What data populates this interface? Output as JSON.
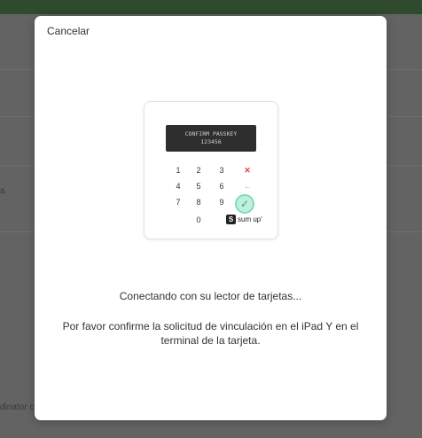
{
  "modal": {
    "cancel_label": "Cancelar",
    "status": "Conectando con su lector de tarjetas...",
    "instructions": "Por favor confirme la solicitud de vinculación en el iPad Y en el terminal de la tarjeta."
  },
  "reader": {
    "screen_line1": "CONFIRM PASSKEY",
    "screen_line2": "123456",
    "keys": [
      "1",
      "2",
      "3",
      "4",
      "5",
      "6",
      "7",
      "8",
      "9",
      "0"
    ],
    "cancel_key": "✕",
    "clear_key": "←",
    "ok_key": "✓",
    "brand_mark": "S",
    "brand_text": "sum up'"
  },
  "background": {
    "partial_left_text": "a",
    "bottom_text": "dinator co"
  },
  "colors": {
    "topbar": "#2f4a2c",
    "overlay": "#636363",
    "cancel_key": "#e0443c",
    "clear_key": "#f0a83a",
    "ok_key": "#2aa77a"
  }
}
